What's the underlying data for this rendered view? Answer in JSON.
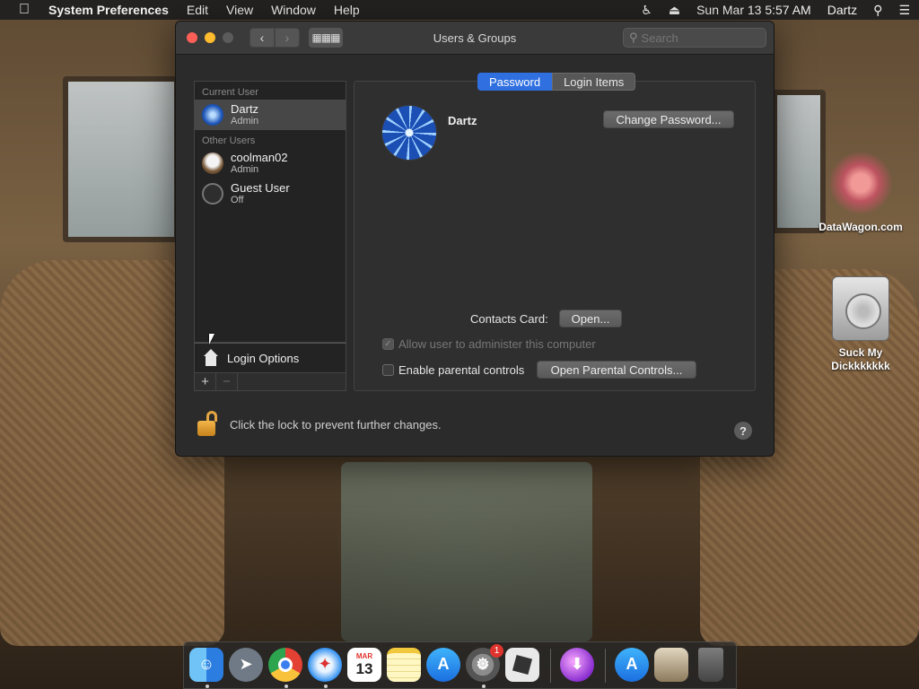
{
  "menubar": {
    "app_name": "System Preferences",
    "menus": [
      "Edit",
      "View",
      "Window",
      "Help"
    ],
    "date_time": "Sun Mar 13  5:57 AM",
    "user": "Dartz",
    "icons": [
      "apple-icon",
      "accessibility-icon",
      "eject-icon",
      "spotlight-icon",
      "list-icon"
    ]
  },
  "desktop": {
    "item1_label": "DataWagon.com",
    "item2_label": "Suck My Dickkkkkkk"
  },
  "window": {
    "title": "Users & Groups",
    "search_placeholder": "Search"
  },
  "sidebar": {
    "current_user_header": "Current User",
    "current_user": {
      "name": "Dartz",
      "role": "Admin"
    },
    "other_users_header": "Other Users",
    "other_users": [
      {
        "name": "coolman02",
        "role": "Admin"
      },
      {
        "name": "Guest User",
        "role": "Off"
      }
    ],
    "login_options_label": "Login Options",
    "add_label": "+",
    "remove_label": "−"
  },
  "tabs": [
    "Password",
    "Login Items"
  ],
  "detail": {
    "user_name": "Dartz",
    "change_password_label": "Change Password...",
    "contacts_card_label": "Contacts Card:",
    "open_label": "Open...",
    "allow_admin_label": "Allow user to administer this computer",
    "parental_controls_label": "Enable parental controls",
    "open_parental_label": "Open Parental Controls..."
  },
  "footer": {
    "lock_text": "Click the lock to prevent further changes.",
    "help_label": "?"
  },
  "dock": {
    "calendar_month": "MAR",
    "calendar_day": "13",
    "sysprefs_badge": "1"
  },
  "colors": {
    "accent": "#2f6fe0",
    "lock": "#e4a640",
    "badge": "#e0332d"
  }
}
